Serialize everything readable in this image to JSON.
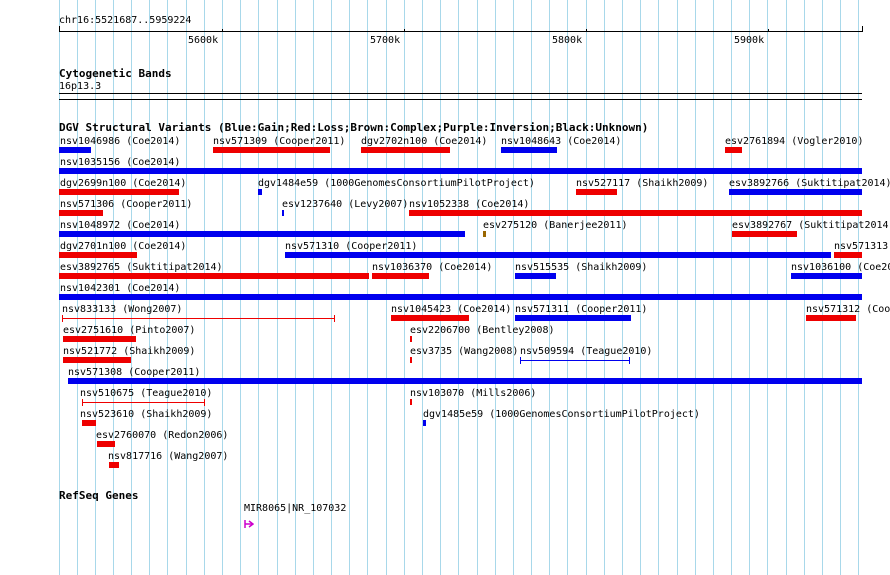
{
  "header": {
    "region": "chr16:5521687..5959224",
    "ruler_ticks": [
      "5600k",
      "5700k",
      "5800k",
      "5900k"
    ]
  },
  "cytogenetic": {
    "title": "Cytogenetic Bands",
    "band": "16p13.3"
  },
  "dgv": {
    "title": "DGV Structural Variants (Blue:Gain;Red:Loss;Brown:Complex;Purple:Inversion;Black:Unknown)",
    "colors": {
      "gain": "#0000ee",
      "loss": "#ee0000",
      "complex": "#996600",
      "inversion": "#cc00cc",
      "unknown": "#000000"
    },
    "features": [
      {
        "label": "nsv1046986 (Coe2014)",
        "type": "gain"
      },
      {
        "label": "nsv571309 (Cooper2011)",
        "type": "loss"
      },
      {
        "label": "dgv2702n100 (Coe2014)",
        "type": "loss"
      },
      {
        "label": "nsv1048643 (Coe2014)",
        "type": "gain"
      },
      {
        "label": "esv2761894 (Vogler2010)",
        "type": "loss"
      },
      {
        "label": "nsv1035156 (Coe2014)",
        "type": "gain"
      },
      {
        "label": "dgv2699n100 (Coe2014)",
        "type": "loss"
      },
      {
        "label": "dgv1484e59 (1000GenomesConsortiumPilotProject)",
        "type": "gain"
      },
      {
        "label": "nsv527117 (Shaikh2009)",
        "type": "loss"
      },
      {
        "label": "esv3892766 (Suktitipat2014)",
        "type": "gain"
      },
      {
        "label": "nsv571306 (Cooper2011)",
        "type": "loss"
      },
      {
        "label": "esv1237640 (Levy2007)",
        "type": "gain"
      },
      {
        "label": "nsv1052338 (Coe2014)",
        "type": "loss"
      },
      {
        "label": "nsv1048972 (Coe2014)",
        "type": "gain"
      },
      {
        "label": "esv275120 (Banerjee2011)",
        "type": "complex"
      },
      {
        "label": "esv3892767 (Suktitipat2014)",
        "type": "loss"
      },
      {
        "label": "dgv2701n100 (Coe2014)",
        "type": "loss"
      },
      {
        "label": "nsv571310 (Cooper2011)",
        "type": "gain"
      },
      {
        "label": "nsv571313",
        "type": "loss"
      },
      {
        "label": "esv3892765 (Suktitipat2014)",
        "type": "loss"
      },
      {
        "label": "nsv1036370 (Coe2014)",
        "type": "loss"
      },
      {
        "label": "nsv515535 (Shaikh2009)",
        "type": "gain"
      },
      {
        "label": "nsv1036100 (Coe20",
        "type": "gain"
      },
      {
        "label": "nsv1042301 (Coe2014)",
        "type": "gain"
      },
      {
        "label": "nsv833133 (Wong2007)",
        "type": "loss"
      },
      {
        "label": "nsv1045423 (Coe2014)",
        "type": "loss"
      },
      {
        "label": "nsv571311 (Cooper2011)",
        "type": "gain"
      },
      {
        "label": "nsv571312 (Coo",
        "type": "loss"
      },
      {
        "label": "esv2751610 (Pinto2007)",
        "type": "loss"
      },
      {
        "label": "esv2206700 (Bentley2008)",
        "type": "loss"
      },
      {
        "label": "nsv521772 (Shaikh2009)",
        "type": "loss"
      },
      {
        "label": "esv3735 (Wang2008)",
        "type": "loss"
      },
      {
        "label": "nsv509594 (Teague2010)",
        "type": "gain"
      },
      {
        "label": "nsv571308 (Cooper2011)",
        "type": "gain"
      },
      {
        "label": "nsv510675 (Teague2010)",
        "type": "loss"
      },
      {
        "label": "nsv103070 (Mills2006)",
        "type": "loss"
      },
      {
        "label": "nsv523610 (Shaikh2009)",
        "type": "loss"
      },
      {
        "label": "dgv1485e59 (1000GenomesConsortiumPilotProject)",
        "type": "gain"
      },
      {
        "label": "esv2760070 (Redon2006)",
        "type": "loss"
      },
      {
        "label": "nsv817716 (Wang2007)",
        "type": "loss"
      }
    ]
  },
  "refseq": {
    "title": "RefSeq Genes",
    "gene": "MIR8065|NR_107032",
    "color": "#cc00cc"
  }
}
